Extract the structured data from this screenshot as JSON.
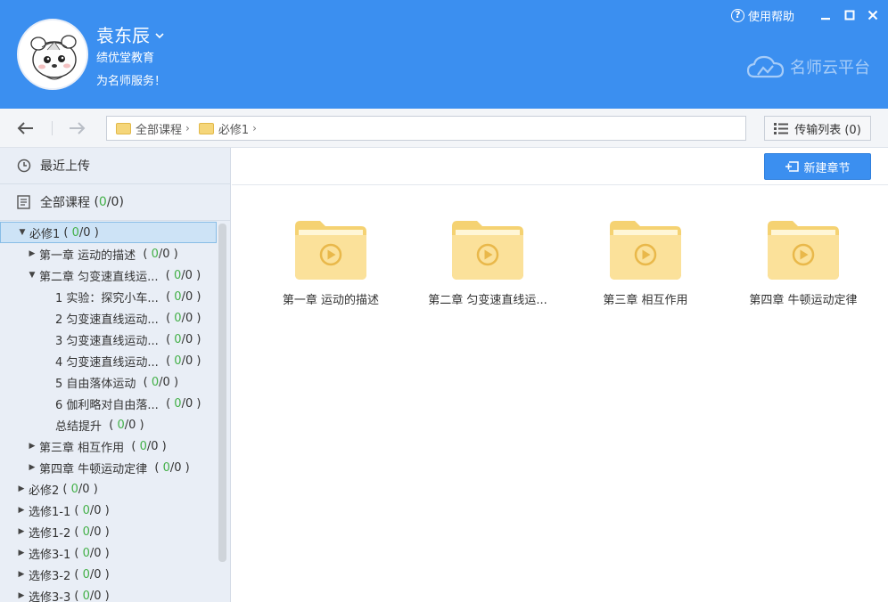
{
  "header": {
    "user_name": "袁东辰",
    "org": "绩优堂教育",
    "slogan": "为名师服务！",
    "help_label": "使用帮助",
    "brand": "名师云平台",
    "colors": {
      "header_bg": "#3b8ff0",
      "accent": "#3b8ff0",
      "count_green": "#43b048"
    }
  },
  "toolbar": {
    "breadcrumb": [
      {
        "label": "全部课程",
        "icon": "folder-icon"
      },
      {
        "label": "必修1",
        "icon": "folder-icon"
      }
    ],
    "transfer_label": "传输列表 (0)"
  },
  "sidebar": {
    "recent_label": "最近上传",
    "all_label": "全部课程",
    "all_count_prefix": " (",
    "all_count": "0",
    "all_count_suffix": "/0)",
    "tree": [
      {
        "label": "必修1",
        "count": "0",
        "indent": 0,
        "arrow": "down",
        "selected": true
      },
      {
        "label": "第一章 运动的描述",
        "count": "0",
        "indent": 1,
        "arrow": "right"
      },
      {
        "label": "第二章 匀变速直线运...",
        "count": "0",
        "indent": 1,
        "arrow": "down"
      },
      {
        "label": "1 实验：探究小车...",
        "count": "0",
        "indent": 2,
        "arrow": ""
      },
      {
        "label": "2 匀变速直线运动...",
        "count": "0",
        "indent": 2,
        "arrow": ""
      },
      {
        "label": "3 匀变速直线运动...",
        "count": "0",
        "indent": 2,
        "arrow": ""
      },
      {
        "label": "4 匀变速直线运动...",
        "count": "0",
        "indent": 2,
        "arrow": ""
      },
      {
        "label": "5 自由落体运动",
        "count": "0",
        "indent": 2,
        "arrow": ""
      },
      {
        "label": "6 伽利略对自由落...",
        "count": "0",
        "indent": 2,
        "arrow": ""
      },
      {
        "label": "总结提升",
        "count": "0",
        "indent": 2,
        "arrow": ""
      },
      {
        "label": "第三章 相互作用",
        "count": "0",
        "indent": 1,
        "arrow": "right"
      },
      {
        "label": "第四章 牛顿运动定律",
        "count": "0",
        "indent": 1,
        "arrow": "right"
      },
      {
        "label": "必修2",
        "count": "0",
        "indent": 0,
        "arrow": "right"
      },
      {
        "label": "选修1-1",
        "count": "0",
        "indent": 0,
        "arrow": "right"
      },
      {
        "label": "选修1-2",
        "count": "0",
        "indent": 0,
        "arrow": "right"
      },
      {
        "label": "选修3-1",
        "count": "0",
        "indent": 0,
        "arrow": "right"
      },
      {
        "label": "选修3-2",
        "count": "0",
        "indent": 0,
        "arrow": "right"
      },
      {
        "label": "选修3-3",
        "count": "0",
        "indent": 0,
        "arrow": "right"
      }
    ]
  },
  "main": {
    "new_chapter_label": "新建章节",
    "folders": [
      {
        "label": "第一章 运动的描述"
      },
      {
        "label": "第二章 匀变速直线运..."
      },
      {
        "label": "第三章 相互作用"
      },
      {
        "label": "第四章 牛顿运动定律"
      }
    ]
  }
}
